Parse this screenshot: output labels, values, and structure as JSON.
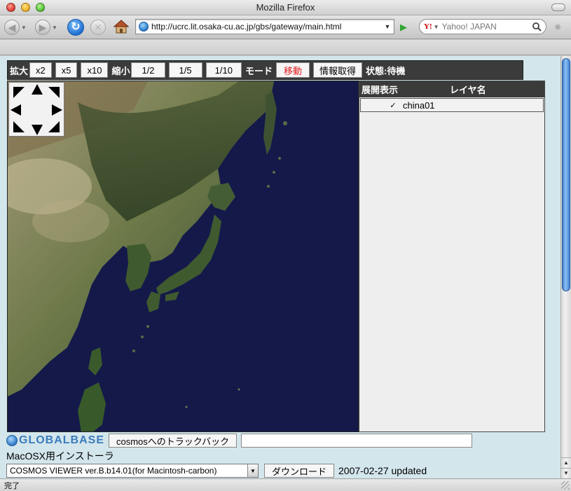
{
  "window": {
    "title": "Mozilla Firefox"
  },
  "browser": {
    "url": "http://ucrc.lit.osaka-cu.ac.jp/gbs/gateway/main.html",
    "search_placeholder": "Yahoo! JAPAN",
    "search_engine_icon": "Y!",
    "status": "完了"
  },
  "toolbar": {
    "zoom_in_label": "拡大",
    "zoom_in_buttons": [
      "x2",
      "x5",
      "x10"
    ],
    "zoom_out_label": "縮小",
    "zoom_out_buttons": [
      "1/2",
      "1/5",
      "1/10"
    ],
    "mode_label": "モード",
    "mode_move": "移動",
    "mode_info": "情報取得",
    "status_text": "状態:待機",
    "active_color": "#e01a1a"
  },
  "layers": {
    "headers": [
      "展開",
      "表示",
      "レイヤ名"
    ],
    "rows": [
      {
        "expand": "",
        "visible_mark": "✓",
        "name": "china01"
      }
    ]
  },
  "footer": {
    "logo_text": "GLOBALBASE",
    "trackback_button": "cosmosへのトラックバック",
    "trackback_value": "",
    "installer_label": "MacOSX用インストーラ",
    "version_selected": "COSMOS VIEWER ver.B.b14.01(for Macintosh-carbon)",
    "download_button": "ダウンロード",
    "updated_text": "2007-02-27 updated"
  }
}
